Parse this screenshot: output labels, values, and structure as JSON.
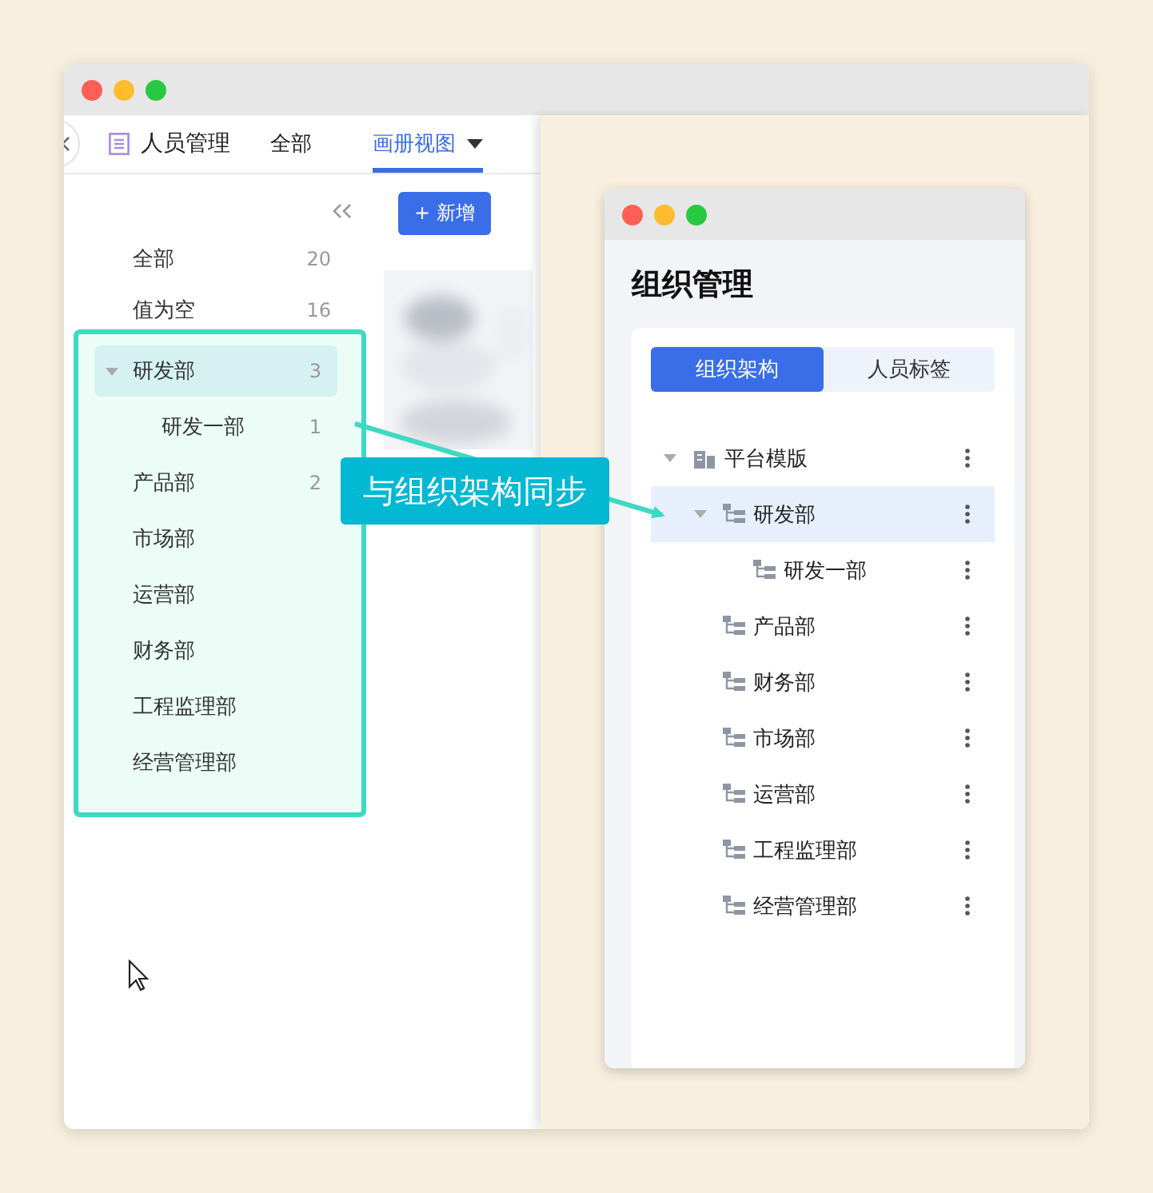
{
  "main_window": {
    "header": {
      "title": "人员管理",
      "tabs": [
        {
          "label": "全部",
          "selected": false,
          "dropdown": false
        },
        {
          "label": "画册视图",
          "selected": true,
          "dropdown": true
        }
      ]
    },
    "sidebar": {
      "items": [
        {
          "label": "全部",
          "count": "20",
          "selected": false
        },
        {
          "label": "值为空",
          "count": "16",
          "selected": false
        }
      ],
      "highlighted_items": [
        {
          "label": "研发部",
          "count": "3",
          "selected": true,
          "expanded": true,
          "children": [
            {
              "label": "研发一部",
              "count": "1",
              "selected": false
            }
          ]
        },
        {
          "label": "产品部",
          "count": "2",
          "selected": false
        },
        {
          "label": "市场部",
          "selected": false
        },
        {
          "label": "运营部",
          "selected": false
        },
        {
          "label": "财务部",
          "selected": false
        },
        {
          "label": "工程监理部",
          "selected": false
        },
        {
          "label": "经营管理部",
          "selected": false
        }
      ]
    },
    "add_button": "+ 新增"
  },
  "org_window": {
    "title": "组织管理",
    "tabs": [
      {
        "label": "组织架构",
        "selected": true
      },
      {
        "label": "人员标签",
        "selected": false
      }
    ],
    "tree": [
      {
        "label": "平台模版",
        "kind": "root",
        "expanded": true,
        "selected": false,
        "children": [
          {
            "label": "研发部",
            "kind": "dept",
            "expanded": true,
            "selected": true,
            "children": [
              {
                "label": "研发一部",
                "kind": "dept",
                "selected": false
              }
            ]
          },
          {
            "label": "产品部",
            "kind": "dept",
            "selected": false
          },
          {
            "label": "财务部",
            "kind": "dept",
            "selected": false
          },
          {
            "label": "市场部",
            "kind": "dept",
            "selected": false
          },
          {
            "label": "运营部",
            "kind": "dept",
            "selected": false
          },
          {
            "label": "工程监理部",
            "kind": "dept",
            "selected": false
          },
          {
            "label": "经营管理部",
            "kind": "dept",
            "selected": false
          }
        ]
      }
    ]
  },
  "annotation": {
    "text": "与组织架构同步"
  }
}
